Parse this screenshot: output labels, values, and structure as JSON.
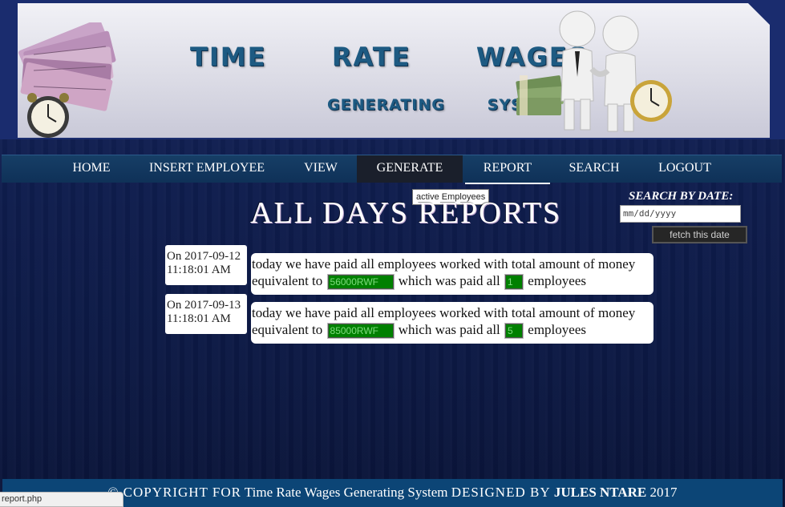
{
  "header": {
    "title_line1": "TIME   RATE   WAGES",
    "title_line2": "GENERATING   SYSTEM"
  },
  "nav": {
    "items": [
      "HOME",
      "INSERT EMPLOYEE",
      "VIEW",
      "GENERATE",
      "REPORT",
      "SEARCH",
      "LOGOUT"
    ],
    "active": "GENERATE",
    "hovered": "REPORT"
  },
  "tooltip": "active Employees",
  "page_title": "ALL DAYS REPORTS",
  "search": {
    "label": "SEARCH BY DATE:",
    "placeholder": "mm/dd/yyyy",
    "button_label": "fetch this date"
  },
  "reports": [
    {
      "date_prefix": "On",
      "date": "2017-09-12",
      "time": "11:18:01 AM",
      "text_a": "today we have paid all employees worked with total amount of money equivalent to",
      "amount": "56000RWF",
      "text_b": "which was paid all",
      "count": "1",
      "text_c": "employees"
    },
    {
      "date_prefix": "On",
      "date": "2017-09-13",
      "time": "11:18:01 AM",
      "text_a": "today we have paid all employees worked with total amount of money equivalent to",
      "amount": "85000RWF",
      "text_b": "which was paid all",
      "count": "5",
      "text_c": "employees"
    }
  ],
  "footer": {
    "copyright": "© COPYRIGHT FOR",
    "system_name": "Time Rate Wages Generating System",
    "designed_by": "DESIGNED BY",
    "author": "JULES NTARE",
    "year": "2017"
  },
  "status_bar": "report.php",
  "colors": {
    "value_bg": "#008000",
    "nav_bg": "#163e66",
    "footer_bg": "#0c4576"
  }
}
